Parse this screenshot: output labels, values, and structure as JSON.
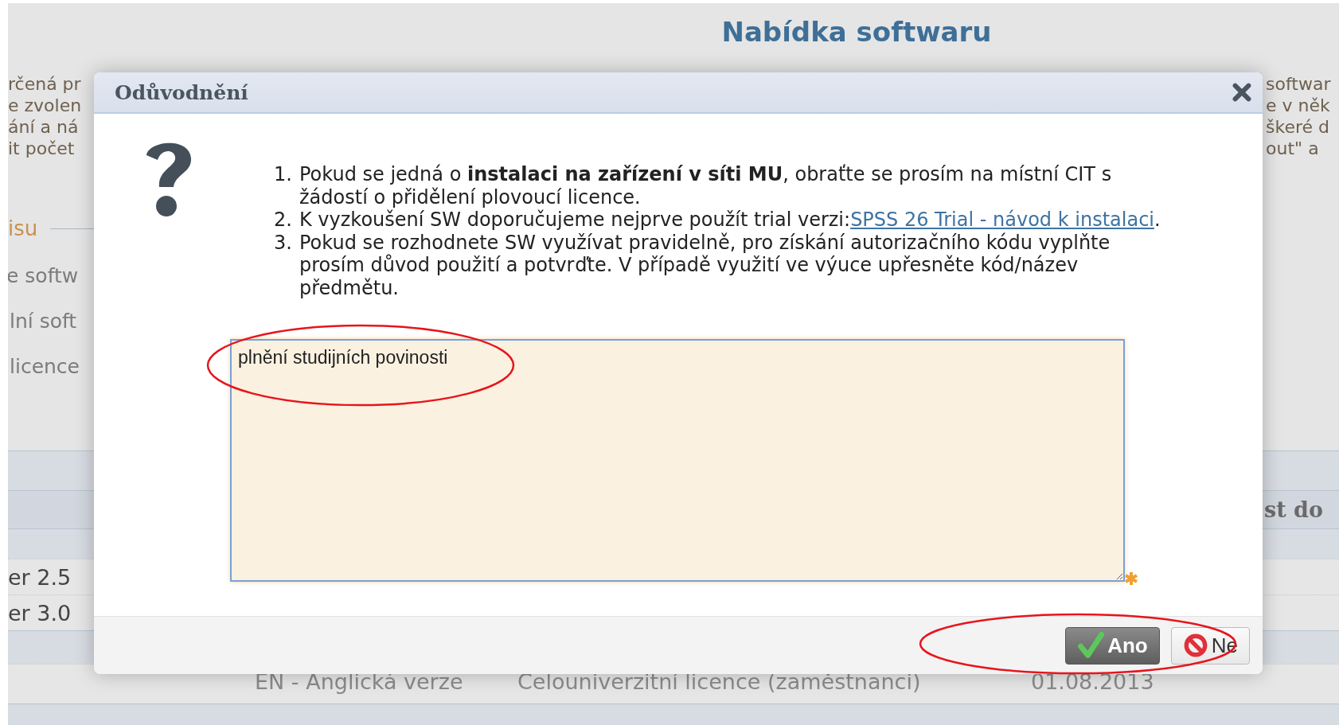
{
  "page": {
    "title": "Nabídka softwaru",
    "left_text": [
      "rčená pr",
      "e zvolen",
      "ání a ná",
      "it počet"
    ],
    "right_text": [
      "softwar",
      "e v něk",
      "škeré d",
      "out\" a"
    ],
    "section_heading": "isu",
    "left_labels": [
      "e softw",
      "lní soft",
      "licence"
    ],
    "table": {
      "header_fragment": "st do",
      "rows": [
        {
          "column_1": "er 2.5"
        },
        {
          "column_1": "er 3.0"
        }
      ],
      "partial_row": [
        "EN - Anglická verze",
        "Celouniverzitní licence (zaměstnanci)",
        "01.08.2013"
      ]
    }
  },
  "dialog": {
    "title": "Odůvodnění",
    "items": [
      {
        "number": "1.",
        "text": "Pokud se jedná o **instalaci na zařízení v síti MU**, obraťte se prosím na místní CIT s žádostí o přidělení plovoucí licence."
      },
      {
        "number": "2.",
        "text": "K vyzkoušení SW doporučujeme nejprve použít trial verzi:",
        "link": "SPSS 26 Trial - návod k instalaci",
        "after": "."
      },
      {
        "number": "3.",
        "text": "Pokud se rozhodnete SW využívat pravidelně, pro získání autorizačního kódu vyplňte prosím důvod použití a potvrďte. V případě využití ve výuce upřesněte kód/název předmětu."
      }
    ],
    "reason": {
      "value": "plnění studijních povinosti"
    },
    "buttons": [
      {
        "label": "Ano",
        "kind": "confirm"
      },
      {
        "label": "Ne",
        "kind": "cancel"
      }
    ]
  }
}
